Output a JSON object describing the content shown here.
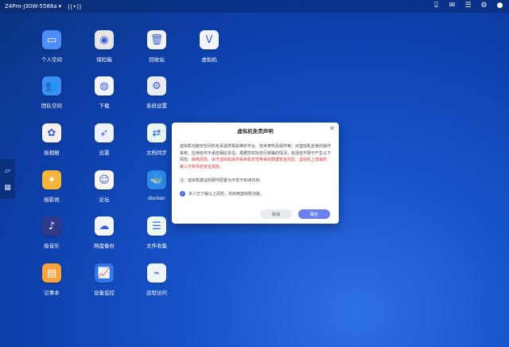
{
  "topbar": {
    "device_name": "Z4Pro-J30W-5588a",
    "dropdown_glyph": "▾",
    "wifi_glyph": "((•))",
    "icons": [
      {
        "name": "pin-icon",
        "glyph": "⍗"
      },
      {
        "name": "mail-icon",
        "glyph": "✉"
      },
      {
        "name": "list-icon",
        "glyph": "☰"
      },
      {
        "name": "settings-icon",
        "glyph": "⚙"
      },
      {
        "name": "user-icon",
        "glyph": "●"
      }
    ]
  },
  "desktop_icons": [
    {
      "label": "个人空间",
      "glyph": "▭",
      "bg": "#4d8df7",
      "icon": "folder-icon"
    },
    {
      "label": "保险箱",
      "glyph": "◉",
      "bg": "#e4e6ea",
      "icon": "safe-icon"
    },
    {
      "label": "回收站",
      "glyph": "🗑",
      "bg": "#f2f3f5",
      "icon": "trash-icon"
    },
    {
      "label": "虚拟机",
      "glyph": "V",
      "bg": "#f2f4ff",
      "icon": "vm-icon"
    },
    {
      "label": "团队空间",
      "glyph": "👥",
      "bg": "#3b8ff2",
      "icon": "team-folder-icon"
    },
    {
      "label": "下载",
      "glyph": "◍",
      "bg": "#f2f4f8",
      "icon": "download-icon"
    },
    {
      "label": "系统设置",
      "glyph": "⚙",
      "bg": "#e9ecf1",
      "icon": "settings-icon"
    },
    {
      "label": "极相册",
      "glyph": "✿",
      "bg": "#f5f0ee",
      "icon": "photos-icon"
    },
    {
      "label": "迅雷",
      "glyph": "➶",
      "bg": "#eef1fb",
      "icon": "thunder-icon"
    },
    {
      "label": "文档同步",
      "glyph": "⇄",
      "bg": "#e7f8ef",
      "icon": "sync-icon"
    },
    {
      "label": "极影视",
      "glyph": "✦",
      "bg": "#f3b53c",
      "icon": "video-icon"
    },
    {
      "label": "论坛",
      "glyph": "☺",
      "bg": "#f8f4ef",
      "icon": "forum-icon"
    },
    {
      "label": "docker",
      "glyph": "🐳",
      "bg": "#2a88e6",
      "icon": "docker-icon"
    },
    {
      "label": "极音乐",
      "glyph": "♪",
      "bg": "#2f3a8a",
      "icon": "music-icon"
    },
    {
      "label": "网盘备份",
      "glyph": "☁",
      "bg": "#f2f4f8",
      "icon": "cloud-backup-icon"
    },
    {
      "label": "文件收集",
      "glyph": "☰",
      "bg": "#edf8f0",
      "icon": "file-collect-icon"
    },
    {
      "label": "记事本",
      "glyph": "▤",
      "bg": "#f7a23a",
      "icon": "notepad-icon"
    },
    {
      "label": "设备监控",
      "glyph": "📈",
      "bg": "#2f76e8",
      "icon": "monitor-icon"
    },
    {
      "label": "远程访问",
      "glyph": "⌁",
      "bg": "#eef5fb",
      "icon": "remote-access-icon"
    }
  ],
  "side_dock": {
    "items": [
      {
        "name": "laptop-icon",
        "glyph": "▱"
      },
      {
        "name": "apps-grid-icon",
        "glyph": "▦"
      }
    ]
  },
  "dialog": {
    "title": "虚拟机免责声明",
    "close_glyph": "✕",
    "body_normal": "虚拟机功能仅空间仅负责提供相关维护平台、技术架构及组件等，对虚拟机自身的操作系统、应用软件不承担相应责任。根据您实际自行部署的情况，包括但不限于产生以下风险：",
    "body_warning": "版权风险、由于虚拟机操作系统稳定性带来的数据安全风险、虚拟机上安装的第三方软件的安全风险。",
    "note": "注：虚拟机建议的硬件配置为不低于8GB内存。",
    "agree_label": "本人已了解以上风险，并启用虚拟机功能。",
    "agree_check_glyph": "✓",
    "cancel_label": "取消",
    "confirm_label": "确定"
  }
}
